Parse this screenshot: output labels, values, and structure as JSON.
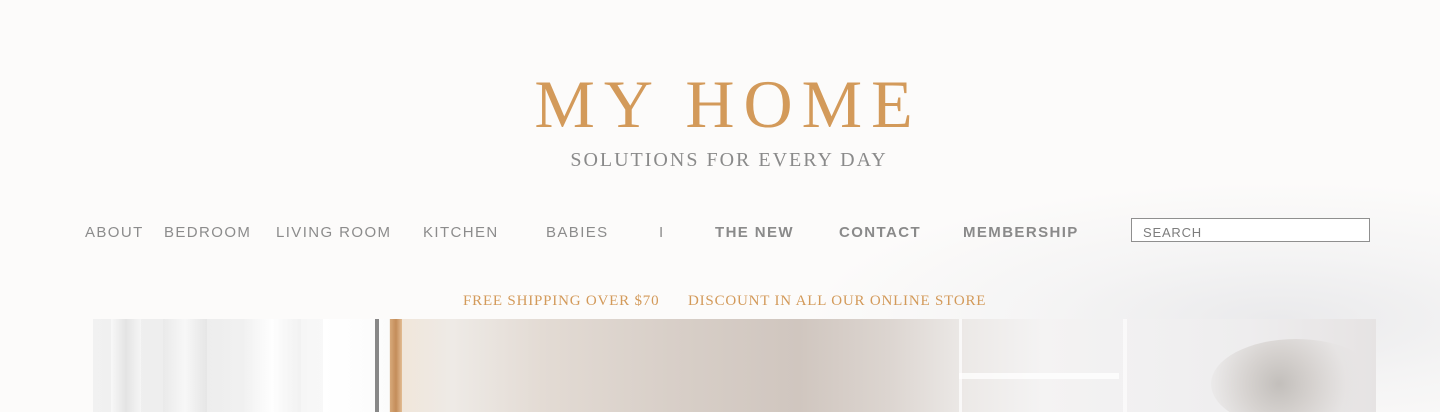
{
  "brand": {
    "logo": "MY HOME",
    "tagline": "SOLUTIONS FOR EVERY DAY"
  },
  "nav": {
    "items": [
      {
        "label": "ABOUT"
      },
      {
        "label": "BEDROOM"
      },
      {
        "label": "LIVING ROOM"
      },
      {
        "label": "KITCHEN"
      },
      {
        "label": "BABIES"
      },
      {
        "label": "I"
      },
      {
        "label": "THE NEW"
      },
      {
        "label": "CONTACT"
      },
      {
        "label": "MEMBERSHIP"
      }
    ]
  },
  "search": {
    "placeholder": "SEARCH"
  },
  "promo": {
    "shipping": "FREE SHIPPING OVER $70",
    "discount": "DISCOUNT IN ALL OUR ONLINE STORE"
  },
  "colors": {
    "accent": "#d39a5a",
    "text_muted": "#8c8c8c",
    "background": "#fcfbfa"
  }
}
